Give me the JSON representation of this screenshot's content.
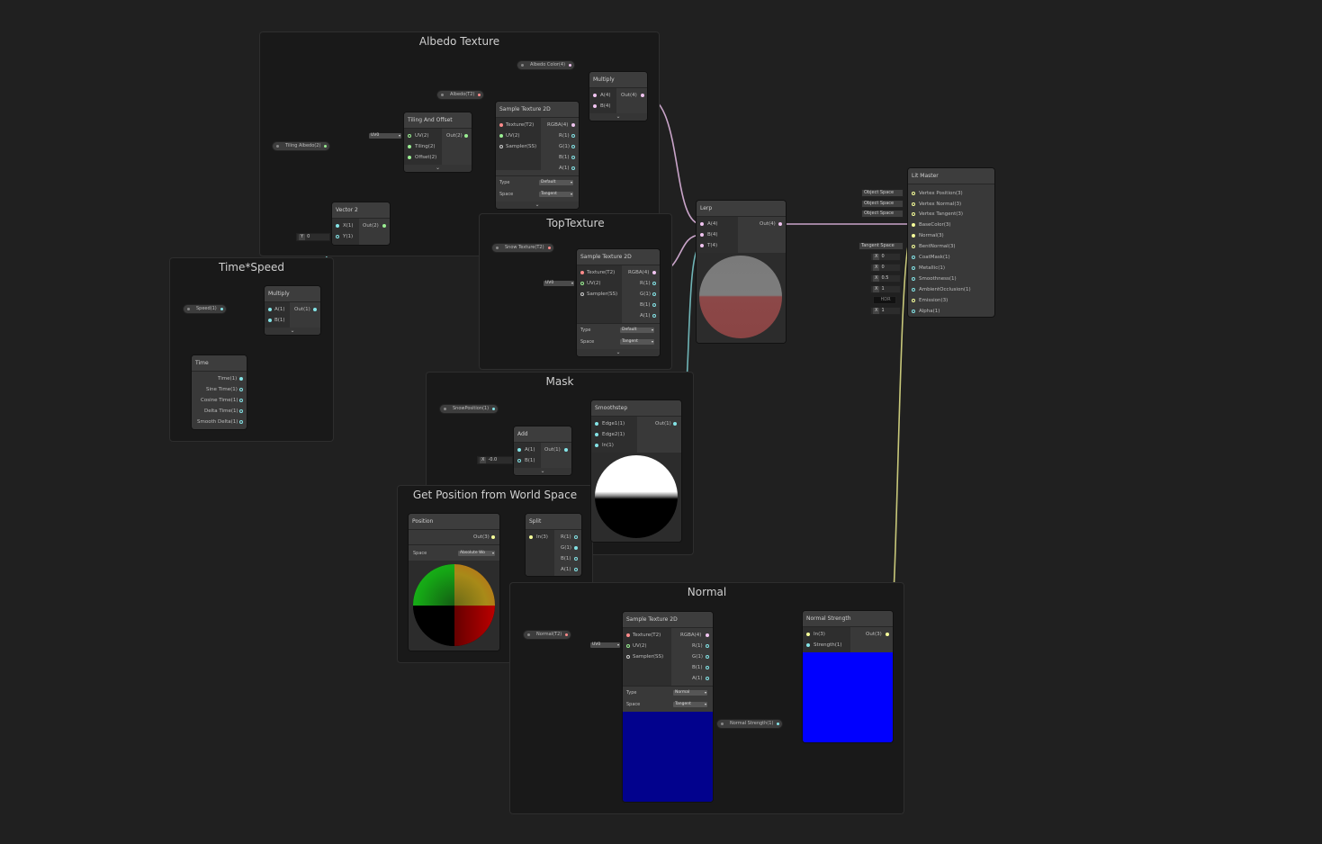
{
  "groups": {
    "albedo": "Albedo Texture",
    "time": "Time*Speed",
    "top": "TopTexture",
    "mask": "Mask",
    "world": "Get Position from World Space",
    "normal": "Normal"
  },
  "props": {
    "albedo_color": "Albedo Color(4)",
    "albedo_tex": "Albedo(T2)",
    "tiling": "Tiling Albedo(2)",
    "speed": "Speed(1)",
    "snow_tex": "Snow Texture(T2)",
    "snow_pos": "SnowPosition(1)",
    "normal_tex": "Normal(T2)",
    "normal_strength": "Normal Strength(1)"
  },
  "nodes": {
    "multiply": {
      "title": "Multiply",
      "a": "A(4)",
      "b": "B(4)",
      "out": "Out(4)"
    },
    "multiply1": {
      "title": "Multiply",
      "a": "A(1)",
      "b": "B(1)",
      "out": "Out(1)"
    },
    "sample": {
      "title": "Sample Texture 2D",
      "texture": "Texture(T2)",
      "uv": "UV(2)",
      "sampler": "Sampler(SS)",
      "rgba": "RGBA(4)",
      "r": "R(1)",
      "g": "G(1)",
      "b": "B(1)",
      "a": "A(1)",
      "type_label": "Type",
      "space_label": "Space",
      "type_default": "Default",
      "type_normal": "Normal",
      "space_value": "Tangent"
    },
    "tiling": {
      "title": "Tiling And Offset",
      "uv": "UV(2)",
      "tiling": "Tiling(2)",
      "offset": "Offset(2)",
      "out": "Out(2)"
    },
    "vector2": {
      "title": "Vector 2",
      "x": "X(1)",
      "y": "Y(1)",
      "out": "Out(2)",
      "y_tag": "Y",
      "y_val": "0"
    },
    "time": {
      "title": "Time",
      "t": "Time(1)",
      "sine": "Sine Time(1)",
      "cos": "Cosine Time(1)",
      "delta": "Delta Time(1)",
      "smooth": "Smooth Delta(1)"
    },
    "lerp": {
      "title": "Lerp",
      "a": "A(4)",
      "b": "B(4)",
      "t": "T(4)",
      "out": "Out(4)"
    },
    "smoothstep": {
      "title": "Smoothstep",
      "e1": "Edge1(1)",
      "e2": "Edge2(1)",
      "in": "In(1)",
      "out": "Out(1)"
    },
    "add": {
      "title": "Add",
      "a": "A(1)",
      "b": "B(1)",
      "out": "Out(1)",
      "x_tag": "X",
      "x_val": "-0.0"
    },
    "position": {
      "title": "Position",
      "out": "Out(3)",
      "space_label": "Space",
      "space_value": "Absolute Wo"
    },
    "split": {
      "title": "Split",
      "in": "In(3)",
      "r": "R(1)",
      "g": "G(1)",
      "b": "B(1)",
      "a": "A(1)"
    },
    "nstrength": {
      "title": "Normal Strength",
      "in": "In(3)",
      "strength": "Strength(1)",
      "out": "Out(3)"
    },
    "master": {
      "title": "Lit Master",
      "ports": [
        "Vertex Position(3)",
        "Vertex Normal(3)",
        "Vertex Tangent(3)",
        "BaseColor(3)",
        "Normal(3)",
        "BentNormal(3)",
        "CoatMask(1)",
        "Metallic(1)",
        "Smoothness(1)",
        "AmbientOcclusion(1)",
        "Emission(3)",
        "Alpha(1)"
      ],
      "object_space": "Object Space",
      "tangent_space": "Tangent Space",
      "x_tag": "X",
      "coat": "0",
      "metal": "0",
      "smooth": "0.5",
      "ao": "1",
      "alpha": "1",
      "hdr": "HDR"
    }
  },
  "uv_label": "UV0",
  "chevron": "⌄",
  "colors": {
    "bg": "#202020",
    "vec4": "#f0c4f0",
    "vec3": "#f6ff9a",
    "vec2": "#9aef92",
    "vec1": "#84e4e7",
    "tex": "#ff8b8b"
  }
}
